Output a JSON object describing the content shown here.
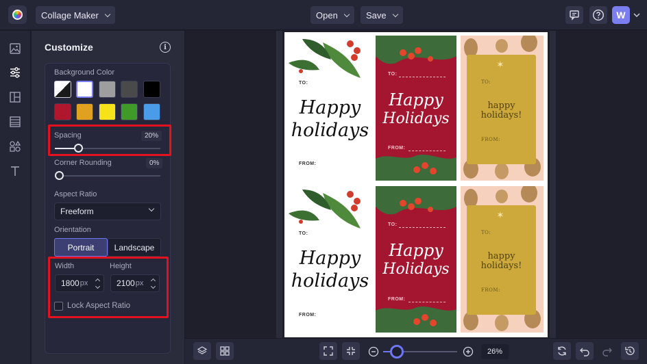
{
  "header": {
    "app_mode": "Collage Maker",
    "open_label": "Open",
    "save_label": "Save",
    "avatar_letter": "W"
  },
  "panel": {
    "title": "Customize",
    "background_color": {
      "label": "Background Color",
      "swatches": [
        "transparent",
        "#ffffff",
        "#9e9e9e",
        "#4a4a4a",
        "#000000",
        "#b0162e",
        "#e0a020",
        "#f6e21a",
        "#3f9a2a",
        "#4a9be8"
      ]
    },
    "spacing": {
      "label": "Spacing",
      "value": "20%",
      "level": 0.2
    },
    "corner_rounding": {
      "label": "Corner Rounding",
      "value": "0%",
      "level": 0
    },
    "aspect_ratio": {
      "label": "Aspect Ratio",
      "selected": "Freeform"
    },
    "orientation": {
      "label": "Orientation",
      "portrait": "Portrait",
      "landscape": "Landscape",
      "active": "Portrait"
    },
    "width": {
      "label": "Width",
      "value": "1800",
      "unit": "px"
    },
    "height": {
      "label": "Height",
      "value": "2100",
      "unit": "px"
    },
    "lock_label": "Lock Aspect Ratio"
  },
  "tags": {
    "to": "TO:",
    "from": "FROM:",
    "white_message_1": "Happy",
    "white_message_2": "holidays",
    "red_message_1": "Happy",
    "red_message_2": "Holidays",
    "gold_to": "TO:",
    "gold_message_1": "happy",
    "gold_message_2": "holidays!",
    "gold_from": "FROM:"
  },
  "zoom": {
    "value": "26%",
    "level": 0.26
  },
  "colors": {
    "accent": "#6f76f2",
    "highlight": "#e3121f",
    "panel": "#2a2b3b"
  }
}
